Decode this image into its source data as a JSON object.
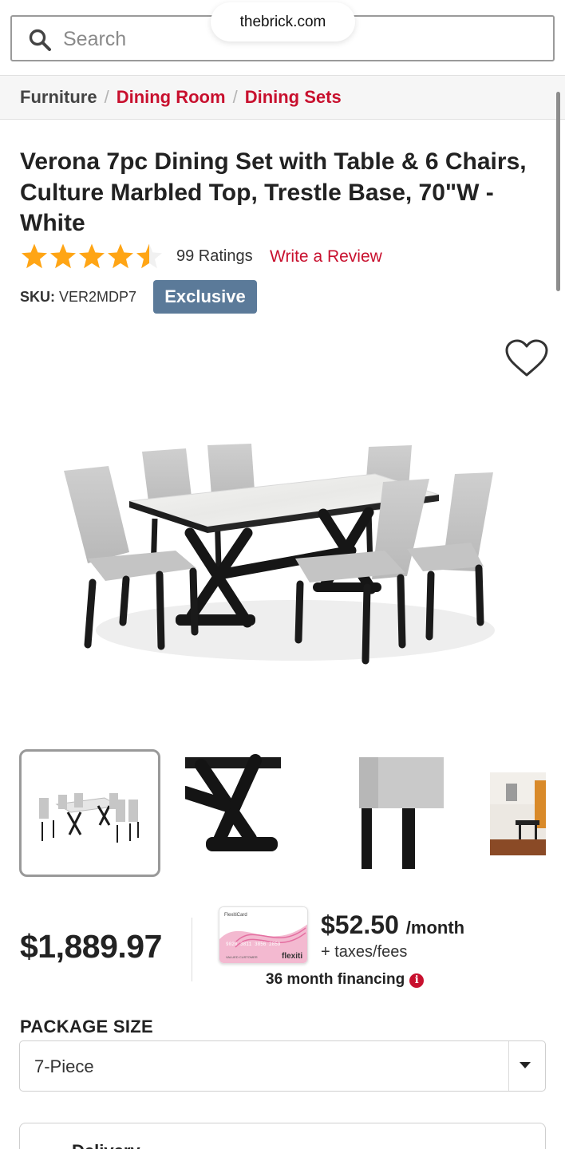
{
  "browser": {
    "url": "thebrick.com"
  },
  "search": {
    "placeholder": "Search"
  },
  "breadcrumb": {
    "items": [
      {
        "label": "Furniture"
      },
      {
        "label": "Dining Room"
      },
      {
        "label": "Dining Sets"
      }
    ],
    "separator": "/"
  },
  "product": {
    "title": "Verona 7pc Dining Set with Table & 6 Chairs, Culture Marbled Top, Trestle Base, 70\"W - White",
    "rating_value": 4.5,
    "rating_max": 5,
    "ratings_count": "99 Ratings",
    "write_review": "Write a Review",
    "sku_label": "SKU:",
    "sku": "VER2MDP7",
    "badge": "Exclusive",
    "price": "$1,889.97"
  },
  "gallery": {
    "thumbnails": [
      "dining-set-thumb",
      "trestle-base-thumb",
      "chair-seat-thumb",
      "room-scene-thumb"
    ],
    "selected_index": 0
  },
  "financing": {
    "monthly": "$52.50",
    "per_month": "/month",
    "taxes": "+ taxes/fees",
    "term": "36 month financing",
    "info_glyph": "i",
    "card": {
      "brand_top": "FlexitiCard",
      "number": "9020 3811 3856 2859",
      "holder": "VALUED CUSTOMER",
      "brand": "flexiti"
    }
  },
  "package": {
    "label": "PACKAGE SIZE",
    "selected": "7-Piece"
  },
  "delivery": {
    "title": "Delivery"
  },
  "colors": {
    "accent_red": "#c8102e",
    "star": "#ffa515",
    "badge": "#5b7a99"
  }
}
